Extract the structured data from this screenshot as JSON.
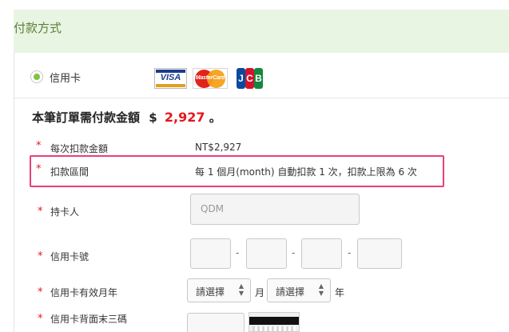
{
  "header": {
    "title": "付款方式"
  },
  "payment_option": {
    "label": "信用卡",
    "selected": true,
    "logos": {
      "visa": "VISA",
      "mastercard": "MasterCard",
      "jcb": [
        "J",
        "C",
        "B"
      ]
    }
  },
  "order_total": {
    "prefix": "本筆訂單需付款金額",
    "currency_symbol": "$",
    "amount": "2,927",
    "suffix": "。"
  },
  "installment": {
    "amount_label": "每次扣款金額",
    "amount_value": "NT$2,927",
    "period_label": "扣款區間",
    "period_value": "每 1 個月(month) 自動扣款 1 次，扣款上限為 6 次"
  },
  "form": {
    "star": "*",
    "cardholder": {
      "label": "持卡人",
      "placeholder": "QDM"
    },
    "card_number": {
      "label": "信用卡號",
      "separator": "-"
    },
    "expiry": {
      "label": "信用卡有效月年",
      "month_select": "請選擇",
      "month_unit": "月",
      "year_select": "請選擇",
      "year_unit": "年"
    },
    "cvv": {
      "label": "信用卡背面末三碼"
    }
  },
  "colors": {
    "accent_green": "#7fc242",
    "header_bg": "#e9f5e3",
    "required_red": "#e4161e",
    "highlight_pink": "#e8407a"
  },
  "icons": {
    "radio": "radio-selected-icon",
    "select_arrow": "up-down-arrow-icon"
  }
}
